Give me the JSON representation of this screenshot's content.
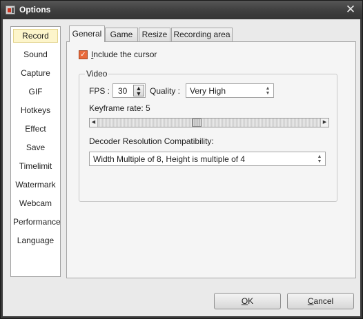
{
  "window": {
    "title": "Options",
    "close_symbol": "✕"
  },
  "sidebar": {
    "items": [
      {
        "label": "Record"
      },
      {
        "label": "Sound"
      },
      {
        "label": "Capture"
      },
      {
        "label": "GIF"
      },
      {
        "label": "Hotkeys"
      },
      {
        "label": "Effect"
      },
      {
        "label": "Save"
      },
      {
        "label": "Timelimit"
      },
      {
        "label": "Watermark"
      },
      {
        "label": "Webcam"
      },
      {
        "label": "Performance"
      },
      {
        "label": "Language"
      }
    ],
    "selected": "Record"
  },
  "tabs": [
    {
      "label": "General"
    },
    {
      "label": "Game"
    },
    {
      "label": "Resize"
    },
    {
      "label": "Recording area"
    }
  ],
  "general": {
    "include_cursor": {
      "checked": true,
      "label_first": "I",
      "label_rest": "nclude the cursor"
    },
    "video": {
      "legend": "Video",
      "fps_label": "FPS :",
      "fps_value": "30",
      "quality_label": "Quality :",
      "quality_value": "Very High",
      "keyframe_label": "Keyframe rate: 5",
      "keyframe_value": 5,
      "decoder_label": "Decoder Resolution Compatibility:",
      "decoder_value": "Width Multiple of 8, Height is multiple of 4"
    }
  },
  "buttons": {
    "ok_first": "O",
    "ok_rest": "K",
    "cancel_first": "C",
    "cancel_rest": "ancel"
  },
  "colors": {
    "checkbox_accent": "#e8693a",
    "selected_item_bg": "#fdf5cb",
    "title_bar": "#3e3e3e"
  }
}
